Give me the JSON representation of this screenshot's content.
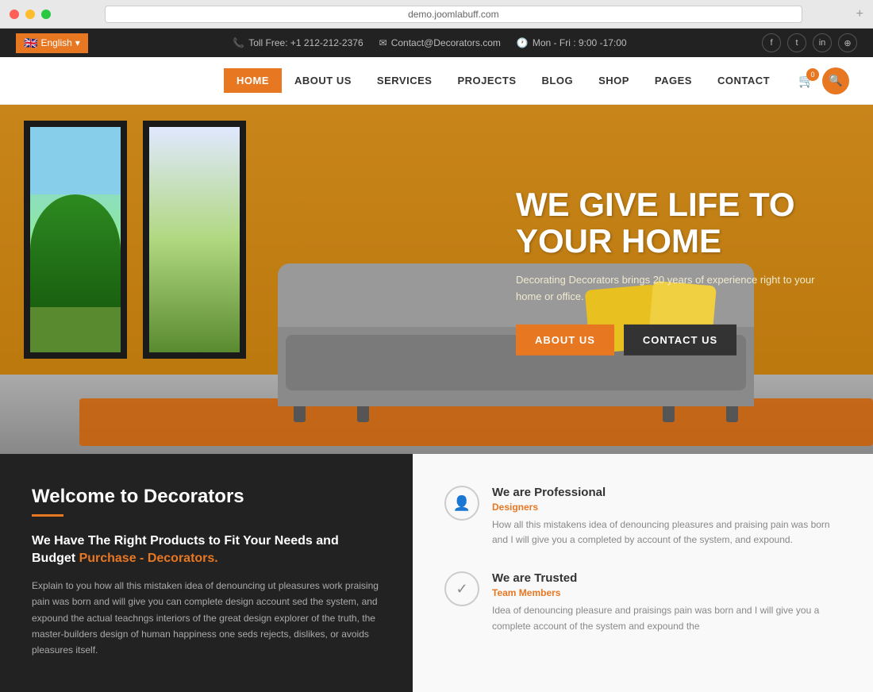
{
  "browser": {
    "url": "demo.joomlabuff.com",
    "expand_icon": "+"
  },
  "topbar": {
    "lang_label": "English",
    "phone_icon": "📞",
    "phone": "Toll Free: +1 212-212-2376",
    "email_icon": "✉",
    "email": "Contact@Decorators.com",
    "clock_icon": "🕐",
    "hours": "Mon - Fri : 9:00 -17:00",
    "social": {
      "facebook": "f",
      "twitter": "t",
      "linkedin": "in",
      "instagram": "⊕"
    }
  },
  "nav": {
    "links": [
      {
        "label": "HOME",
        "active": true
      },
      {
        "label": "ABOUT US",
        "active": false
      },
      {
        "label": "SERVICES",
        "active": false
      },
      {
        "label": "PROJECTS",
        "active": false
      },
      {
        "label": "BLOG",
        "active": false
      },
      {
        "label": "SHOP",
        "active": false
      },
      {
        "label": "PAGES",
        "active": false
      },
      {
        "label": "CONTACT",
        "active": false
      }
    ],
    "cart_count": "0",
    "cart_icon": "🛒",
    "search_icon": "🔍"
  },
  "hero": {
    "title_line1": "WE GIVE LIFE TO",
    "title_line2": "YOUR HOME",
    "subtitle": "Decorating Decorators brings 20 years of experience right to your home or office.",
    "btn_about": "ABOUT US",
    "btn_contact": "CONTACT US"
  },
  "welcome": {
    "title": "Welcome to Decorators",
    "subtitle": "We Have The Right Products to Fit Your Needs and Budget",
    "link_text": "Purchase - Decorators.",
    "body": "Explain to you how all this mistaken idea of denouncing ut pleasures work praising pain was born and will give you can complete design account sed the system, and expound the actual teachngs interiors of the great design explorer of the truth, the master-builders design of human happiness one seds rejects, dislikes, or avoids pleasures itself."
  },
  "features": [
    {
      "icon": "👤",
      "title": "We are Professional",
      "tag": "Designers",
      "body": "How all this mistakens idea of denouncing pleasures and praising pain was born and I will give you a completed by account of the system, and expound."
    },
    {
      "icon": "✓",
      "title": "We are Trusted",
      "tag": "Team Members",
      "body": "Idea of denouncing pleasure and praisings pain was born and I will give you a complete account of the system and expound the"
    }
  ],
  "colors": {
    "orange": "#e87722",
    "dark": "#222222",
    "light_bg": "#f9f9f9"
  }
}
